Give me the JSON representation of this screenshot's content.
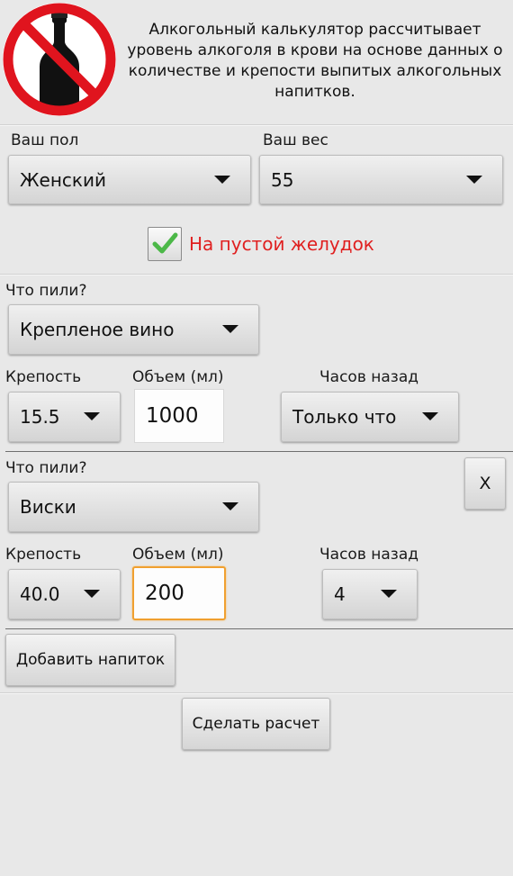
{
  "header": {
    "description": "Алкогольный калькулятор рассчитывает уровень алкоголя в крови на основе данных о количестве и крепости выпитых алкогольных напитков."
  },
  "profile": {
    "gender_label": "Ваш пол",
    "gender_value": "Женский",
    "weight_label": "Ваш вес",
    "weight_value": "55",
    "empty_stomach_label": "На пустой желудок",
    "empty_stomach_checked": true
  },
  "drinks": [
    {
      "what_label": "Что пили?",
      "drink_value": "Крепленое вино",
      "strength_label": "Крепость",
      "strength_value": "15.5",
      "volume_label": "Объем (мл)",
      "volume_value": "1000",
      "hours_label": "Часов назад",
      "hours_value": "Только что"
    },
    {
      "what_label": "Что пили?",
      "drink_value": "Виски",
      "strength_label": "Крепость",
      "strength_value": "40.0",
      "volume_label": "Объем (мл)",
      "volume_value": "200",
      "hours_label": "Часов назад",
      "hours_value": "4",
      "remove_label": "X"
    }
  ],
  "actions": {
    "add_drink_label": "Добавить напиток",
    "calculate_label": "Сделать расчет"
  },
  "colors": {
    "accent_red": "#e02020",
    "focus_orange": "#f0a030",
    "check_green": "#4cb848"
  }
}
